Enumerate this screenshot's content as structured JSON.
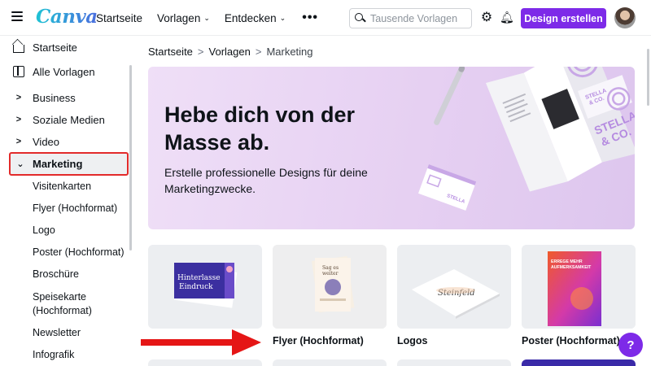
{
  "header": {
    "logo": "Canva",
    "nav": [
      {
        "label": "Startseite",
        "has_chevron": false
      },
      {
        "label": "Vorlagen",
        "has_chevron": true
      },
      {
        "label": "Entdecken",
        "has_chevron": true
      }
    ],
    "more_label": "•••",
    "search_placeholder": "Tausende Vorlagen",
    "cta_label": "Design erstellen",
    "icons": [
      "menu-icon",
      "search-icon",
      "gear-icon",
      "bell-icon",
      "user-avatar"
    ]
  },
  "sidebar": {
    "top_items": [
      {
        "label": "Startseite",
        "icon": "home-icon"
      },
      {
        "label": "Alle Vorlagen",
        "icon": "templates-icon"
      }
    ],
    "categories": [
      {
        "label": "Business",
        "expanded": false
      },
      {
        "label": "Soziale Medien",
        "expanded": false
      },
      {
        "label": "Video",
        "expanded": false
      },
      {
        "label": "Marketing",
        "expanded": true
      }
    ],
    "sub_items": [
      {
        "label": "Visitenkarten"
      },
      {
        "label": "Flyer (Hochformat)"
      },
      {
        "label": "Logo"
      },
      {
        "label": "Poster (Hochformat)"
      },
      {
        "label": "Broschüre"
      },
      {
        "label": "Speisekarte\n(Hochformat)"
      },
      {
        "label": "Newsletter"
      },
      {
        "label": "Infografik"
      }
    ]
  },
  "breadcrumb": {
    "items": [
      "Startseite",
      "Vorlagen",
      "Marketing"
    ],
    "separator": ">"
  },
  "hero": {
    "title": "Hebe dich von der Masse ab.",
    "text": "Erstelle professionelle Designs für deine Marketingzwecke.",
    "art_text": {
      "brand": "STELLA & CO.",
      "brand_short": "STELLA\n& CO."
    }
  },
  "cards": [
    {
      "label": "",
      "thumb_text": "Hinterlasse Eindruck"
    },
    {
      "label": "Flyer (Hochformat)",
      "thumb_text": "Sag es weiter"
    },
    {
      "label": "Logos",
      "thumb_text": "Steinfeld"
    },
    {
      "label": "Poster (Hochformat)",
      "thumb_text": "ERREGE MEHR AUFMERKSAMKEIT"
    }
  ],
  "help_label": "?",
  "colors": {
    "accent": "#7d2ae8",
    "highlight_border": "#e22b2b",
    "arrow": "#e51616"
  }
}
